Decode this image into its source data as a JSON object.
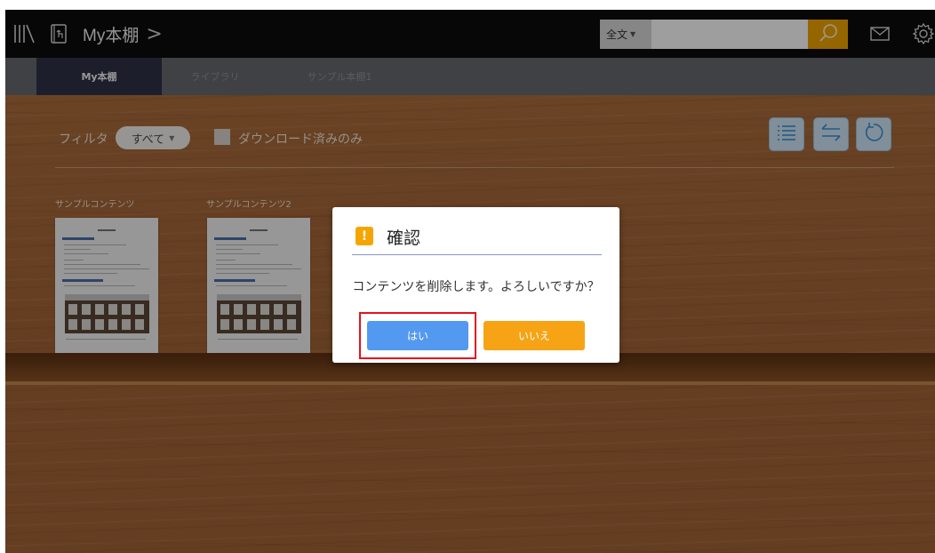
{
  "header": {
    "title": "My本棚",
    "title_chevron": ">",
    "search": {
      "scope": "全文",
      "value": "",
      "placeholder": ""
    },
    "icons": [
      "library-icon",
      "book-tap-icon",
      "search-icon",
      "mail-icon",
      "gear-icon"
    ]
  },
  "tabs": [
    {
      "label": "My本棚",
      "active": true
    },
    {
      "label": "ライブラリ",
      "active": false
    },
    {
      "label": "サンプル本棚1",
      "active": false
    }
  ],
  "toolbar": {
    "filter_label": "フィルタ",
    "filter_value": "すべて",
    "downloaded_only_label": "ダウンロード済みのみ",
    "downloaded_only_checked": false,
    "icons": [
      "list-view-icon",
      "sort-icon",
      "refresh-icon"
    ]
  },
  "books": [
    {
      "title": "サンプルコンテンツ"
    },
    {
      "title": "サンプルコンテンツ2"
    }
  ],
  "dialog": {
    "title": "確認",
    "message": "コンテンツを削除します。よろしいですか？",
    "yes_label": "はい",
    "no_label": "いいえ",
    "highlighted_button": "yes"
  },
  "colors": {
    "topbar": "#0c0c0c",
    "active_tab": "#2e3346",
    "search_button": "#f0a500",
    "wood": "#a66839",
    "yes_button": "#5499f0",
    "no_button": "#f6a416",
    "warning_icon": "#f4a500",
    "highlight_border": "#e5121d"
  }
}
